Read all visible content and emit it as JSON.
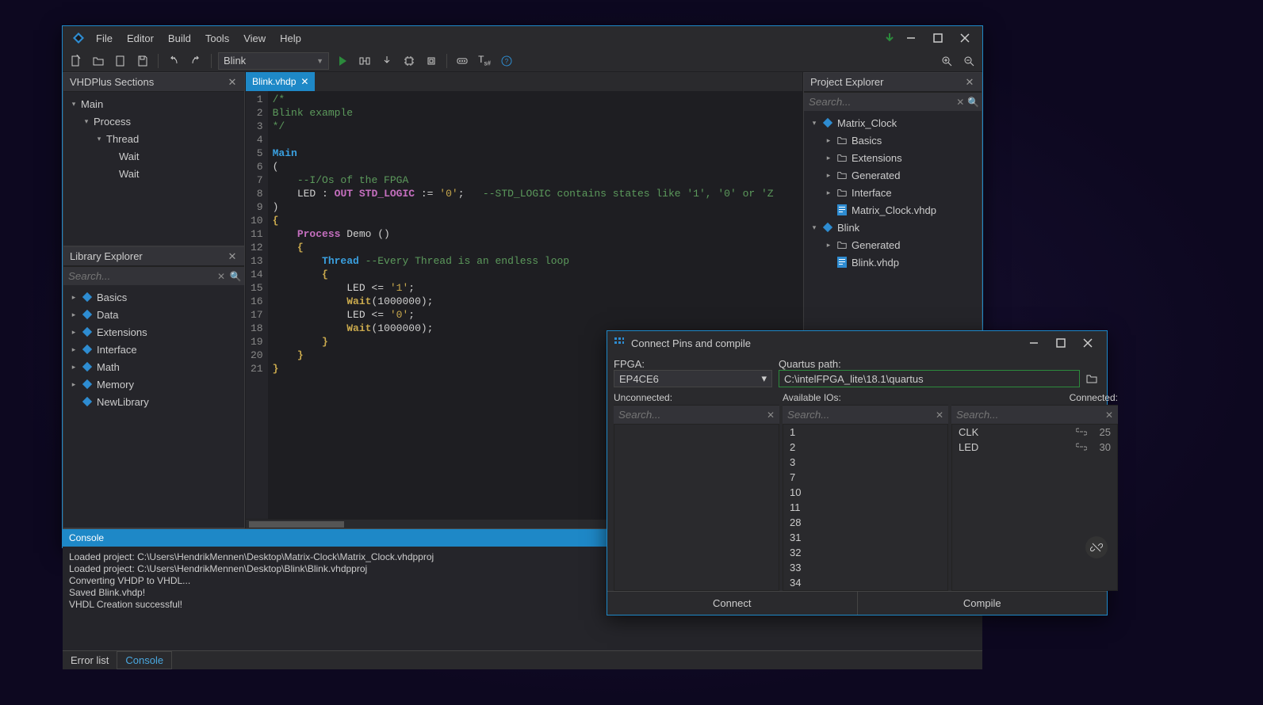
{
  "menubar": [
    "File",
    "Editor",
    "Build",
    "Tools",
    "View",
    "Help"
  ],
  "toolbar": {
    "combo": "Blink"
  },
  "sections": {
    "title": "VHDPlus Sections",
    "tree": [
      {
        "label": "Main",
        "indent": 0,
        "arrow": "▾"
      },
      {
        "label": "Process",
        "indent": 1,
        "arrow": "▾"
      },
      {
        "label": "Thread",
        "indent": 2,
        "arrow": "▾"
      },
      {
        "label": "Wait",
        "indent": 3,
        "arrow": ""
      },
      {
        "label": "Wait",
        "indent": 3,
        "arrow": ""
      }
    ]
  },
  "library": {
    "title": "Library Explorer",
    "search_ph": "Search...",
    "items": [
      "Basics",
      "Data",
      "Extensions",
      "Interface",
      "Math",
      "Memory",
      "NewLibrary"
    ]
  },
  "tab": {
    "label": "Blink.vhdp"
  },
  "code": {
    "lines": [
      [
        {
          "t": "/*",
          "c": "c-comment-b"
        }
      ],
      [
        {
          "t": "Blink example",
          "c": "c-comment-b"
        }
      ],
      [
        {
          "t": "*/",
          "c": "c-comment-b"
        }
      ],
      [
        {
          "t": "",
          "c": ""
        }
      ],
      [
        {
          "t": "Main",
          "c": "c-kw"
        }
      ],
      [
        {
          "t": "(",
          "c": "c-pun"
        }
      ],
      [
        {
          "t": "    ",
          "c": ""
        },
        {
          "t": "--I/Os of the FPGA",
          "c": "c-comment"
        }
      ],
      [
        {
          "t": "    LED ",
          "c": ""
        },
        {
          "t": ": ",
          "c": "c-pun"
        },
        {
          "t": "OUT ",
          "c": "c-kw2"
        },
        {
          "t": "STD_LOGIC",
          "c": "c-type"
        },
        {
          "t": " := ",
          "c": ""
        },
        {
          "t": "'0'",
          "c": "c-str"
        },
        {
          "t": ";",
          "c": "c-pun"
        },
        {
          "t": "   ",
          "c": ""
        },
        {
          "t": "--STD_LOGIC contains states like '1', '0' or 'Z",
          "c": "c-comment"
        }
      ],
      [
        {
          "t": ")",
          "c": "c-pun"
        }
      ],
      [
        {
          "t": "{",
          "c": "c-func"
        }
      ],
      [
        {
          "t": "    ",
          "c": ""
        },
        {
          "t": "Process",
          "c": "c-kw2"
        },
        {
          "t": " Demo ()",
          "c": ""
        }
      ],
      [
        {
          "t": "    ",
          "c": ""
        },
        {
          "t": "{",
          "c": "c-func"
        }
      ],
      [
        {
          "t": "        ",
          "c": ""
        },
        {
          "t": "Thread",
          "c": "c-kw"
        },
        {
          "t": " ",
          "c": ""
        },
        {
          "t": "--Every Thread is an endless loop",
          "c": "c-comment"
        }
      ],
      [
        {
          "t": "        ",
          "c": ""
        },
        {
          "t": "{",
          "c": "c-func"
        }
      ],
      [
        {
          "t": "            LED <= ",
          "c": ""
        },
        {
          "t": "'1'",
          "c": "c-str"
        },
        {
          "t": ";",
          "c": "c-pun"
        }
      ],
      [
        {
          "t": "            ",
          "c": ""
        },
        {
          "t": "Wait",
          "c": "c-func"
        },
        {
          "t": "(",
          "c": "c-pun"
        },
        {
          "t": "1000000",
          "c": ""
        },
        {
          "t": ");",
          "c": "c-pun"
        }
      ],
      [
        {
          "t": "            LED <= ",
          "c": ""
        },
        {
          "t": "'0'",
          "c": "c-str"
        },
        {
          "t": ";",
          "c": "c-pun"
        }
      ],
      [
        {
          "t": "            ",
          "c": ""
        },
        {
          "t": "Wait",
          "c": "c-func"
        },
        {
          "t": "(",
          "c": "c-pun"
        },
        {
          "t": "1000000",
          "c": ""
        },
        {
          "t": ");",
          "c": "c-pun"
        }
      ],
      [
        {
          "t": "        ",
          "c": ""
        },
        {
          "t": "}",
          "c": "c-func"
        }
      ],
      [
        {
          "t": "    ",
          "c": ""
        },
        {
          "t": "}",
          "c": "c-func"
        }
      ],
      [
        {
          "t": "}",
          "c": "c-func"
        }
      ]
    ]
  },
  "project": {
    "title": "Project Explorer",
    "search_ph": "Search...",
    "tree": [
      {
        "label": "Matrix_Clock",
        "indent": 0,
        "arrow": "▾",
        "icon": "proj"
      },
      {
        "label": "Basics",
        "indent": 1,
        "arrow": "▸",
        "icon": "folder"
      },
      {
        "label": "Extensions",
        "indent": 1,
        "arrow": "▸",
        "icon": "folder"
      },
      {
        "label": "Generated",
        "indent": 1,
        "arrow": "▸",
        "icon": "folder"
      },
      {
        "label": "Interface",
        "indent": 1,
        "arrow": "▸",
        "icon": "folder"
      },
      {
        "label": "Matrix_Clock.vhdp",
        "indent": 1,
        "arrow": "",
        "icon": "file"
      },
      {
        "label": "Blink",
        "indent": 0,
        "arrow": "▾",
        "icon": "proj"
      },
      {
        "label": "Generated",
        "indent": 1,
        "arrow": "▸",
        "icon": "folder"
      },
      {
        "label": "Blink.vhdp",
        "indent": 1,
        "arrow": "",
        "icon": "file"
      }
    ]
  },
  "console": {
    "title": "Console",
    "lines": [
      "Loaded project: C:\\Users\\HendrikMennen\\Desktop\\Matrix-Clock\\Matrix_Clock.vhdpproj",
      "Loaded project: C:\\Users\\HendrikMennen\\Desktop\\Blink\\Blink.vhdpproj",
      "Converting VHDP to VHDL...",
      "Saved Blink.vhdp!",
      "VHDL Creation successful!"
    ]
  },
  "bottom_tabs": {
    "err": "Error list",
    "con": "Console"
  },
  "dialog": {
    "title": "Connect Pins and compile",
    "fpga_label": "FPGA:",
    "fpga_value": "EP4CE6",
    "qpath_label": "Quartus path:",
    "qpath_value": "C:\\intelFPGA_lite\\18.1\\quartus",
    "unc_label": "Unconnected:",
    "av_label": "Available IOs:",
    "conn_label": "Connected:",
    "search_ph": "Search...",
    "ios": [
      "1",
      "2",
      "3",
      "7",
      "10",
      "11",
      "28",
      "31",
      "32",
      "33",
      "34"
    ],
    "connected": [
      {
        "sig": "CLK",
        "pin": "25"
      },
      {
        "sig": "LED",
        "pin": "30"
      }
    ],
    "connect_btn": "Connect",
    "compile_btn": "Compile"
  }
}
